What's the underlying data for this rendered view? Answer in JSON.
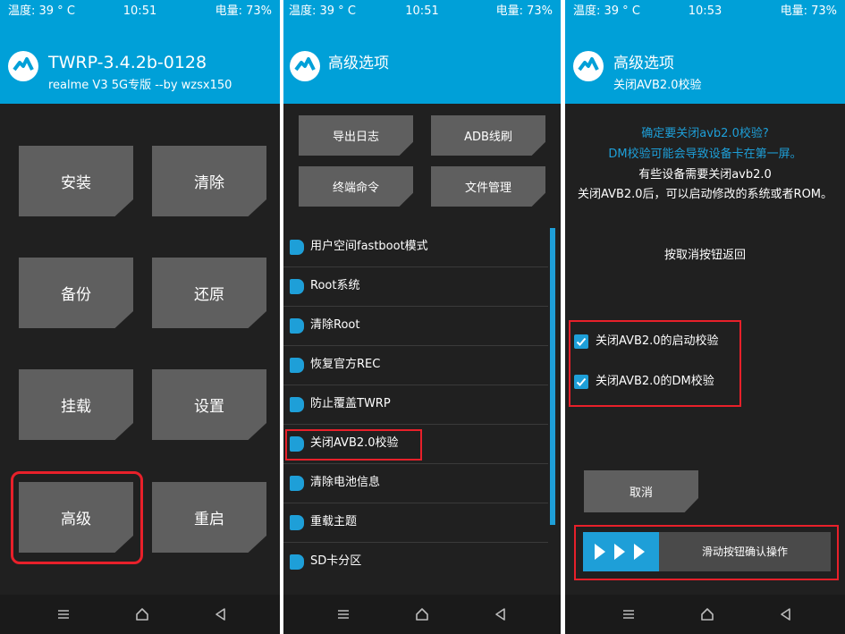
{
  "colors": {
    "accent": "#00a0d8",
    "background": "#202020",
    "tile": "#5f5f5f",
    "highlight": "#e8202a"
  },
  "status": {
    "p1": {
      "temp": "温度: 39 ° C",
      "time": "10:51",
      "battery": "电量: 73%"
    },
    "p2": {
      "temp": "温度: 39 ° C",
      "time": "10:51",
      "battery": "电量: 73%"
    },
    "p3": {
      "temp": "温度: 39 ° C",
      "time": "10:53",
      "battery": "电量: 73%"
    }
  },
  "panel1": {
    "title": "TWRP-3.4.2b-0128",
    "subtitle": "realme V3 5G专版  --by wzsx150",
    "tiles": [
      "安装",
      "清除",
      "备份",
      "还原",
      "挂载",
      "设置",
      "高级",
      "重启"
    ]
  },
  "panel2": {
    "title": "高级选项",
    "buttons": [
      "导出日志",
      "ADB线刷",
      "终端命令",
      "文件管理"
    ],
    "items": [
      "用户空间fastboot模式",
      "Root系统",
      "清除Root",
      "恢复官方REC",
      "防止覆盖TWRP",
      "关闭AVB2.0校验",
      "清除电池信息",
      "重载主题",
      "SD卡分区"
    ]
  },
  "panel3": {
    "title": "高级选项",
    "subtitle": "关闭AVB2.0校验",
    "confirm": "确定要关闭avb2.0校验?",
    "warning": "DM校验可能会导致设备卡在第一屏。",
    "note1": "有些设备需要关闭avb2.0",
    "note2": "关闭AVB2.0后，可以启动修改的系统或者ROM。",
    "cancel_hint": "按取消按钮返回",
    "checkbox1": "关闭AVB2.0的启动校验",
    "checkbox2": "关闭AVB2.0的DM校验",
    "cancel_button": "取消",
    "slider_label": "滑动按钮确认操作"
  },
  "icons": {
    "logo": "twrp-logo-icon",
    "nav_menu": "menu-icon",
    "nav_home": "home-icon",
    "nav_back": "back-icon",
    "checkbox": "check-icon",
    "slider": "arrow-icon"
  }
}
